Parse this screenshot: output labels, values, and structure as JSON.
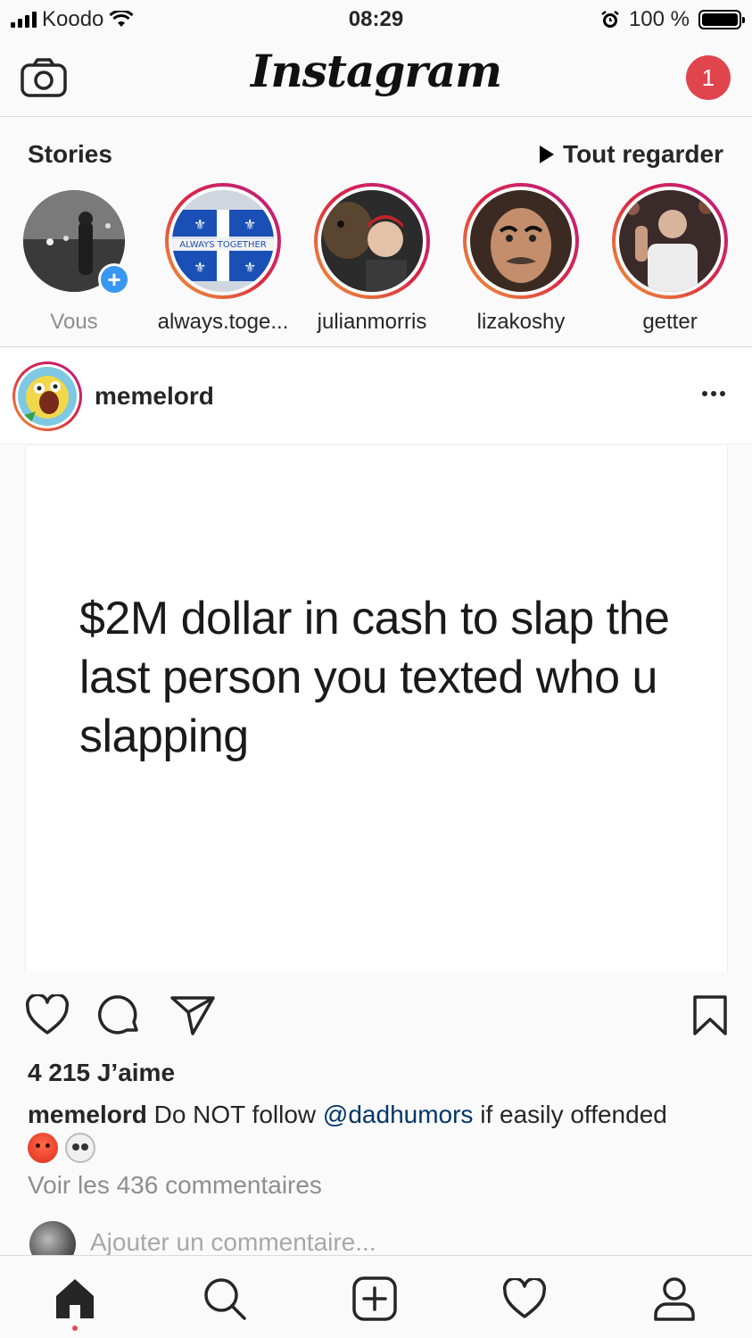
{
  "status_bar": {
    "carrier": "Koodo",
    "time": "08:29",
    "battery": "100 %"
  },
  "header": {
    "logo": "Instagram",
    "notification_count": "1",
    "icons": [
      "camera-icon"
    ]
  },
  "stories": {
    "title": "Stories",
    "watch_all": "Tout regarder",
    "items": [
      {
        "name": "Vous",
        "own": true
      },
      {
        "name": "always.toge..."
      },
      {
        "name": "julianmorris"
      },
      {
        "name": "lizakoshy"
      },
      {
        "name": "getter"
      }
    ],
    "flag_text": "ALWAYS TOGETHER"
  },
  "post": {
    "username": "memelord",
    "image_text": "$2M dollar in cash to slap the last person you texted who u slapping",
    "likes": "4 215 J’aime",
    "caption": {
      "user": "memelord",
      "text_before": " Do NOT follow ",
      "mention": "@dadhumors",
      "text_after": " if easily offended"
    },
    "view_comments": "Voir les 436 commentaires",
    "add_comment_placeholder": "Ajouter un commentaire..."
  },
  "tab_bar": {
    "tabs": [
      "home-icon",
      "search-icon",
      "add-post-icon",
      "activity-heart-icon",
      "profile-icon"
    ]
  },
  "colors": {
    "accent_blue": "#3897f0",
    "badge_red": "#e0454d",
    "mention": "#003569"
  }
}
